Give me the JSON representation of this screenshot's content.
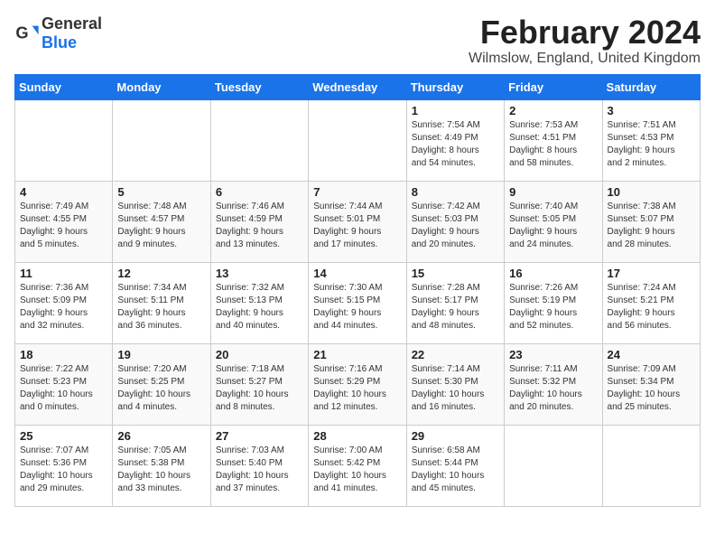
{
  "header": {
    "logo_general": "General",
    "logo_blue": "Blue",
    "month_title": "February 2024",
    "location": "Wilmslow, England, United Kingdom"
  },
  "days_of_week": [
    "Sunday",
    "Monday",
    "Tuesday",
    "Wednesday",
    "Thursday",
    "Friday",
    "Saturday"
  ],
  "weeks": [
    [
      {
        "day": "",
        "info": ""
      },
      {
        "day": "",
        "info": ""
      },
      {
        "day": "",
        "info": ""
      },
      {
        "day": "",
        "info": ""
      },
      {
        "day": "1",
        "info": "Sunrise: 7:54 AM\nSunset: 4:49 PM\nDaylight: 8 hours\nand 54 minutes."
      },
      {
        "day": "2",
        "info": "Sunrise: 7:53 AM\nSunset: 4:51 PM\nDaylight: 8 hours\nand 58 minutes."
      },
      {
        "day": "3",
        "info": "Sunrise: 7:51 AM\nSunset: 4:53 PM\nDaylight: 9 hours\nand 2 minutes."
      }
    ],
    [
      {
        "day": "4",
        "info": "Sunrise: 7:49 AM\nSunset: 4:55 PM\nDaylight: 9 hours\nand 5 minutes."
      },
      {
        "day": "5",
        "info": "Sunrise: 7:48 AM\nSunset: 4:57 PM\nDaylight: 9 hours\nand 9 minutes."
      },
      {
        "day": "6",
        "info": "Sunrise: 7:46 AM\nSunset: 4:59 PM\nDaylight: 9 hours\nand 13 minutes."
      },
      {
        "day": "7",
        "info": "Sunrise: 7:44 AM\nSunset: 5:01 PM\nDaylight: 9 hours\nand 17 minutes."
      },
      {
        "day": "8",
        "info": "Sunrise: 7:42 AM\nSunset: 5:03 PM\nDaylight: 9 hours\nand 20 minutes."
      },
      {
        "day": "9",
        "info": "Sunrise: 7:40 AM\nSunset: 5:05 PM\nDaylight: 9 hours\nand 24 minutes."
      },
      {
        "day": "10",
        "info": "Sunrise: 7:38 AM\nSunset: 5:07 PM\nDaylight: 9 hours\nand 28 minutes."
      }
    ],
    [
      {
        "day": "11",
        "info": "Sunrise: 7:36 AM\nSunset: 5:09 PM\nDaylight: 9 hours\nand 32 minutes."
      },
      {
        "day": "12",
        "info": "Sunrise: 7:34 AM\nSunset: 5:11 PM\nDaylight: 9 hours\nand 36 minutes."
      },
      {
        "day": "13",
        "info": "Sunrise: 7:32 AM\nSunset: 5:13 PM\nDaylight: 9 hours\nand 40 minutes."
      },
      {
        "day": "14",
        "info": "Sunrise: 7:30 AM\nSunset: 5:15 PM\nDaylight: 9 hours\nand 44 minutes."
      },
      {
        "day": "15",
        "info": "Sunrise: 7:28 AM\nSunset: 5:17 PM\nDaylight: 9 hours\nand 48 minutes."
      },
      {
        "day": "16",
        "info": "Sunrise: 7:26 AM\nSunset: 5:19 PM\nDaylight: 9 hours\nand 52 minutes."
      },
      {
        "day": "17",
        "info": "Sunrise: 7:24 AM\nSunset: 5:21 PM\nDaylight: 9 hours\nand 56 minutes."
      }
    ],
    [
      {
        "day": "18",
        "info": "Sunrise: 7:22 AM\nSunset: 5:23 PM\nDaylight: 10 hours\nand 0 minutes."
      },
      {
        "day": "19",
        "info": "Sunrise: 7:20 AM\nSunset: 5:25 PM\nDaylight: 10 hours\nand 4 minutes."
      },
      {
        "day": "20",
        "info": "Sunrise: 7:18 AM\nSunset: 5:27 PM\nDaylight: 10 hours\nand 8 minutes."
      },
      {
        "day": "21",
        "info": "Sunrise: 7:16 AM\nSunset: 5:29 PM\nDaylight: 10 hours\nand 12 minutes."
      },
      {
        "day": "22",
        "info": "Sunrise: 7:14 AM\nSunset: 5:30 PM\nDaylight: 10 hours\nand 16 minutes."
      },
      {
        "day": "23",
        "info": "Sunrise: 7:11 AM\nSunset: 5:32 PM\nDaylight: 10 hours\nand 20 minutes."
      },
      {
        "day": "24",
        "info": "Sunrise: 7:09 AM\nSunset: 5:34 PM\nDaylight: 10 hours\nand 25 minutes."
      }
    ],
    [
      {
        "day": "25",
        "info": "Sunrise: 7:07 AM\nSunset: 5:36 PM\nDaylight: 10 hours\nand 29 minutes."
      },
      {
        "day": "26",
        "info": "Sunrise: 7:05 AM\nSunset: 5:38 PM\nDaylight: 10 hours\nand 33 minutes."
      },
      {
        "day": "27",
        "info": "Sunrise: 7:03 AM\nSunset: 5:40 PM\nDaylight: 10 hours\nand 37 minutes."
      },
      {
        "day": "28",
        "info": "Sunrise: 7:00 AM\nSunset: 5:42 PM\nDaylight: 10 hours\nand 41 minutes."
      },
      {
        "day": "29",
        "info": "Sunrise: 6:58 AM\nSunset: 5:44 PM\nDaylight: 10 hours\nand 45 minutes."
      },
      {
        "day": "",
        "info": ""
      },
      {
        "day": "",
        "info": ""
      }
    ]
  ]
}
